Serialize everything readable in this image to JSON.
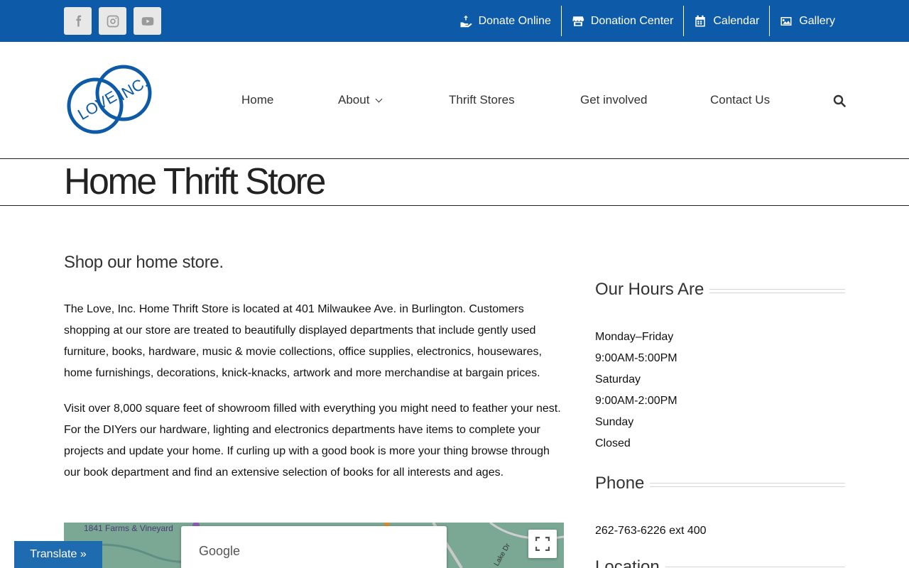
{
  "topbar": {
    "social": [
      {
        "name": "facebook-icon",
        "label": "f"
      },
      {
        "name": "instagram-icon",
        "label": "instagram"
      },
      {
        "name": "youtube-icon",
        "label": "youtube"
      }
    ],
    "links": [
      "Donate Online",
      "Donation Center",
      "Calendar",
      "Gallery"
    ]
  },
  "header": {
    "nav": [
      "Home",
      "About",
      "Thrift Stores",
      "Get involved",
      "Contact Us"
    ]
  },
  "page": {
    "title": "Home Thrift Store",
    "subtitle": "Shop our home store.",
    "paragraphs": [
      "The Love, Inc. Home Thrift Store is located at 401 Milwaukee Ave. in Burlington. Customers shopping at our store are treated to beautifully displayed departments that include gently used furniture, books, hardware, music & movie collections, office supplies, electronics, housewares, home furnishings, decorations, knick-knacks, artwork and more merchandise at bargain prices.",
      "Visit over 8,000 square feet of showroom filled with everything you might need to feather your nest. For the DIYers our hardware, lighting and electronics departments have items to complete your projects and update your home. If curling up with a good book is more your thing browse through our book department and find an extensive selection of books for all interests and ages."
    ]
  },
  "map": {
    "place_label": "1841 Farms & Vineyard",
    "road_label": "Lake Dr",
    "google_label": "Google"
  },
  "sidebar": {
    "hours_heading": "Our Hours Are",
    "hours": [
      "Monday–Friday",
      "9:00AM-5:00PM",
      "Saturday",
      "9:00AM-2:00PM",
      "Sunday",
      "Closed"
    ],
    "phone_heading": "Phone",
    "phone": "262-763-6226 ext 400",
    "location_heading": "Location"
  },
  "translate": {
    "label": "Translate »"
  },
  "colors": {
    "topbar": "#0d5ba8",
    "logo_blue": "#0d5ba8"
  }
}
